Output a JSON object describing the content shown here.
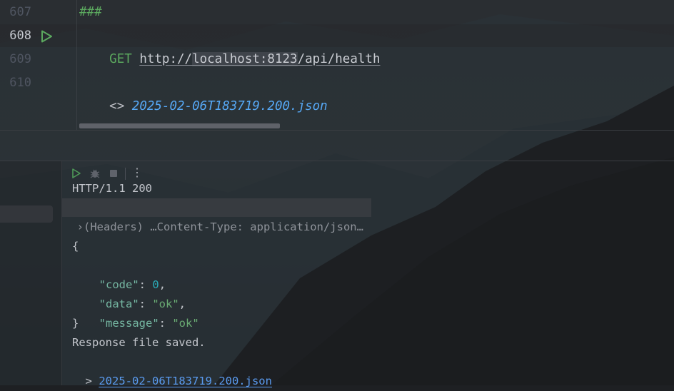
{
  "editor": {
    "lines": [
      {
        "number": "607",
        "text": "###"
      },
      {
        "number": "608",
        "method": "GET",
        "url_prefix": "http://",
        "url_host": "localhost:8123",
        "url_path": "/api/health"
      },
      {
        "number": "609",
        "text": ""
      },
      {
        "number": "610",
        "prefix": "<>",
        "link": "2025-02-06T183719.200.json"
      }
    ]
  },
  "toolbar": {
    "icons": [
      "run-icon",
      "debug-icon",
      "stop-icon",
      "more-icon"
    ],
    "more_label": "⋮"
  },
  "output": {
    "status_line": "HTTP/1.1 200",
    "headers_chevron": "›",
    "headers_summary": "(Headers) …Content-Type: application/json…",
    "json_open": "{",
    "json_close": "}",
    "fields": [
      {
        "key": "\"code\"",
        "value": "0",
        "type": "number",
        "suffix": ","
      },
      {
        "key": "\"data\"",
        "value": "\"ok\"",
        "type": "string",
        "suffix": ","
      },
      {
        "key": "\"message\"",
        "value": "\"ok\"",
        "type": "string",
        "suffix": ""
      }
    ],
    "saved_text": "Response file saved.",
    "saved_prefix": "> ",
    "saved_link": "2025-02-06T183719.200.json"
  },
  "colors": {
    "keyword_green": "#5ca95f",
    "link_blue": "#56a8f5",
    "json_key": "#75b7a2",
    "json_number": "#2aacb8",
    "json_string": "#6aab73"
  }
}
